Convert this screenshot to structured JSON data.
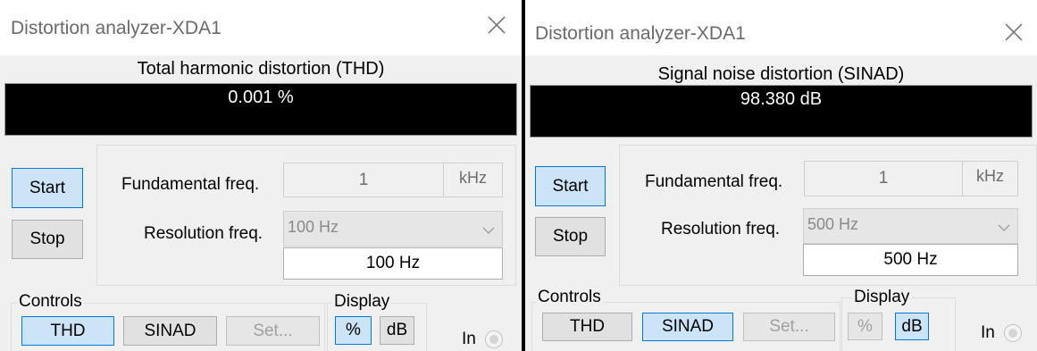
{
  "windows": [
    {
      "title": "Distortion analyzer-XDA1",
      "close_icon": "close-icon",
      "measurement_label": "Total harmonic distortion (THD)",
      "display_value": "0.001 %",
      "start_label": "Start",
      "stop_label": "Stop",
      "fundamental_label": "Fundamental freq.",
      "fundamental_value": "1",
      "fundamental_unit": "kHz",
      "resolution_label": "Resolution freq.",
      "resolution_selected": "100 Hz",
      "resolution_readout": "100 Hz",
      "controls_label": "Controls",
      "thd_label": "THD",
      "sinad_label": "SINAD",
      "set_label": "Set...",
      "display_group_label": "Display",
      "percent_label": "%",
      "db_label": "dB",
      "input_label": "In",
      "active_mode": "THD",
      "active_display": "%"
    },
    {
      "title": "Distortion analyzer-XDA1",
      "close_icon": "close-icon",
      "measurement_label": "Signal noise distortion (SINAD)",
      "display_value": "98.380 dB",
      "start_label": "Start",
      "stop_label": "Stop",
      "fundamental_label": "Fundamental freq.",
      "fundamental_value": "1",
      "fundamental_unit": "kHz",
      "resolution_label": "Resolution freq.",
      "resolution_selected": "500 Hz",
      "resolution_readout": "500 Hz",
      "controls_label": "Controls",
      "thd_label": "THD",
      "sinad_label": "SINAD",
      "set_label": "Set...",
      "display_group_label": "Display",
      "percent_label": "%",
      "db_label": "dB",
      "input_label": "In",
      "active_mode": "SINAD",
      "active_display": "dB"
    }
  ],
  "colors": {
    "active_button": "#cce4f7",
    "active_border": "#0078d7",
    "display_background": "#000000",
    "display_text": "#ffffff"
  }
}
